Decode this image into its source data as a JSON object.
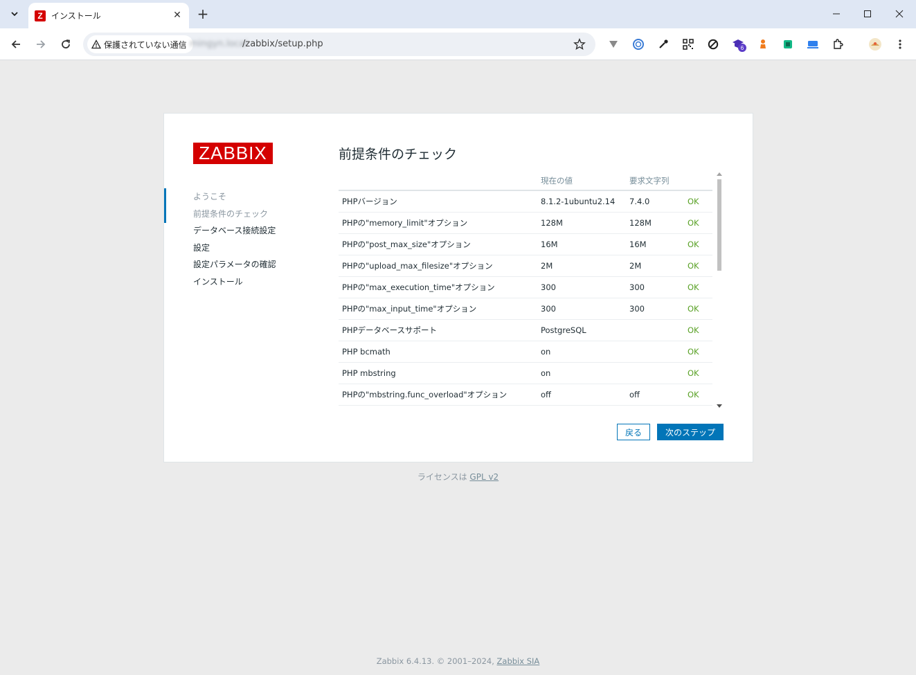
{
  "browser": {
    "tab_title": "インストール",
    "favicon_letter": "Z",
    "security_label": "保護されていない通信",
    "url_host": "mingyn.local",
    "url_path": "/zabbix/setup.php",
    "extension_badge": "6"
  },
  "page": {
    "logo": "ZABBIX",
    "title": "前提条件のチェック",
    "steps": [
      {
        "label": "ようこそ",
        "state": "done"
      },
      {
        "label": "前提条件のチェック",
        "state": "current"
      },
      {
        "label": "データベース接続設定",
        "state": "pending"
      },
      {
        "label": "設定",
        "state": "pending"
      },
      {
        "label": "設定パラメータの確認",
        "state": "pending"
      },
      {
        "label": "インストール",
        "state": "pending"
      }
    ],
    "table": {
      "headers": [
        "",
        "現在の値",
        "要求文字列",
        ""
      ],
      "rows": [
        [
          "PHPバージョン",
          "8.1.2-1ubuntu2.14",
          "7.4.0",
          "OK"
        ],
        [
          "PHPの\"memory_limit\"オプション",
          "128M",
          "128M",
          "OK"
        ],
        [
          "PHPの\"post_max_size\"オプション",
          "16M",
          "16M",
          "OK"
        ],
        [
          "PHPの\"upload_max_filesize\"オプション",
          "2M",
          "2M",
          "OK"
        ],
        [
          "PHPの\"max_execution_time\"オプション",
          "300",
          "300",
          "OK"
        ],
        [
          "PHPの\"max_input_time\"オプション",
          "300",
          "300",
          "OK"
        ],
        [
          "PHPデータベースサポート",
          "PostgreSQL",
          "",
          "OK"
        ],
        [
          "PHP bcmath",
          "on",
          "",
          "OK"
        ],
        [
          "PHP mbstring",
          "on",
          "",
          "OK"
        ],
        [
          "PHPの\"mbstring.func_overload\"オプション",
          "off",
          "off",
          "OK"
        ]
      ]
    },
    "back_button": "戻る",
    "next_button": "次のステップ",
    "license_prefix": "ライセンスは",
    "license_link": "GPL v2",
    "footer_text": "Zabbix 6.4.13. © 2001–2024,",
    "footer_link": "Zabbix SIA"
  },
  "colors": {
    "accent": "#0275b8",
    "ok": "#59a125",
    "logo": "#d40000"
  }
}
